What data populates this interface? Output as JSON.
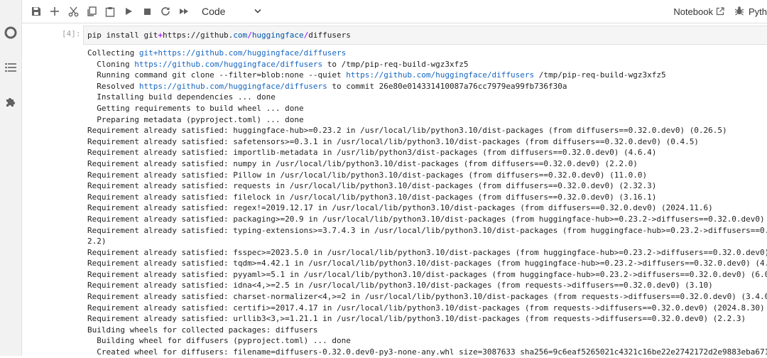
{
  "toolbar": {
    "cell_type": "Code",
    "notebook_label": "Notebook",
    "kernel_label": "Pyth"
  },
  "cell": {
    "prompt": "[4]:",
    "code_prefix": "pip install git",
    "code_op": "+",
    "code_url_prefix": "https://github.",
    "code_com": "com",
    "code_sep1": "/",
    "code_huggingface": "huggingface",
    "code_sep2": "/",
    "code_repo": "diffusers"
  },
  "output": {
    "lines": [
      {
        "pre": "Collecting ",
        "link": "git+https://github.com/huggingface/diffusers",
        "post": ""
      },
      {
        "pre": "  Cloning ",
        "link": "https://github.com/huggingface/diffusers",
        "post": " to /tmp/pip-req-build-wgz3xfz5"
      },
      {
        "pre": "  Running command git clone --filter=blob:none --quiet ",
        "link": "https://github.com/huggingface/diffusers",
        "post": " /tmp/pip-req-build-wgz3xfz5"
      },
      {
        "pre": "  Resolved ",
        "link": "https://github.com/huggingface/diffusers",
        "post": " to commit 26e80e014331410087a76cc7979ea99fb736f30a"
      },
      {
        "pre": "  Installing build dependencies ... done",
        "link": "",
        "post": ""
      },
      {
        "pre": "  Getting requirements to build wheel ... done",
        "link": "",
        "post": ""
      },
      {
        "pre": "  Preparing metadata (pyproject.toml) ... done",
        "link": "",
        "post": ""
      },
      {
        "pre": "Requirement already satisfied: huggingface-hub>=0.23.2 in /usr/local/lib/python3.10/dist-packages (from diffusers==0.32.0.dev0) (0.26.5)",
        "link": "",
        "post": ""
      },
      {
        "pre": "Requirement already satisfied: safetensors>=0.3.1 in /usr/local/lib/python3.10/dist-packages (from diffusers==0.32.0.dev0) (0.4.5)",
        "link": "",
        "post": ""
      },
      {
        "pre": "Requirement already satisfied: importlib-metadata in /usr/lib/python3/dist-packages (from diffusers==0.32.0.dev0) (4.6.4)",
        "link": "",
        "post": ""
      },
      {
        "pre": "Requirement already satisfied: numpy in /usr/local/lib/python3.10/dist-packages (from diffusers==0.32.0.dev0) (2.2.0)",
        "link": "",
        "post": ""
      },
      {
        "pre": "Requirement already satisfied: Pillow in /usr/local/lib/python3.10/dist-packages (from diffusers==0.32.0.dev0) (11.0.0)",
        "link": "",
        "post": ""
      },
      {
        "pre": "Requirement already satisfied: requests in /usr/local/lib/python3.10/dist-packages (from diffusers==0.32.0.dev0) (2.32.3)",
        "link": "",
        "post": ""
      },
      {
        "pre": "Requirement already satisfied: filelock in /usr/local/lib/python3.10/dist-packages (from diffusers==0.32.0.dev0) (3.16.1)",
        "link": "",
        "post": ""
      },
      {
        "pre": "Requirement already satisfied: regex!=2019.12.17 in /usr/local/lib/python3.10/dist-packages (from diffusers==0.32.0.dev0) (2024.11.6)",
        "link": "",
        "post": ""
      },
      {
        "pre": "Requirement already satisfied: packaging>=20.9 in /usr/local/lib/python3.10/dist-packages (from huggingface-hub>=0.23.2->diffusers==0.32.0.dev0)",
        "link": "",
        "post": ""
      },
      {
        "pre": "Requirement already satisfied: typing-extensions>=3.7.4.3 in /usr/local/lib/python3.10/dist-packages (from huggingface-hub>=0.23.2->diffusers==0.3",
        "link": "",
        "post": ""
      },
      {
        "pre": "2.2)",
        "link": "",
        "post": ""
      },
      {
        "pre": "Requirement already satisfied: fsspec>=2023.5.0 in /usr/local/lib/python3.10/dist-packages (from huggingface-hub>=0.23.2->diffusers==0.32.0.dev0)",
        "link": "",
        "post": ""
      },
      {
        "pre": "Requirement already satisfied: tqdm>=4.42.1 in /usr/local/lib/python3.10/dist-packages (from huggingface-hub>=0.23.2->diffusers==0.32.0.dev0) (4.6",
        "link": "",
        "post": ""
      },
      {
        "pre": "Requirement already satisfied: pyyaml>=5.1 in /usr/local/lib/python3.10/dist-packages (from huggingface-hub>=0.23.2->diffusers==0.32.0.dev0) (6.0",
        "link": "",
        "post": ""
      },
      {
        "pre": "Requirement already satisfied: idna<4,>=2.5 in /usr/local/lib/python3.10/dist-packages (from requests->diffusers==0.32.0.dev0) (3.10)",
        "link": "",
        "post": ""
      },
      {
        "pre": "Requirement already satisfied: charset-normalizer<4,>=2 in /usr/local/lib/python3.10/dist-packages (from requests->diffusers==0.32.0.dev0) (3.4.0",
        "link": "",
        "post": ""
      },
      {
        "pre": "Requirement already satisfied: certifi>=2017.4.17 in /usr/local/lib/python3.10/dist-packages (from requests->diffusers==0.32.0.dev0) (2024.8.30)",
        "link": "",
        "post": ""
      },
      {
        "pre": "Requirement already satisfied: urllib3<3,>=1.21.1 in /usr/local/lib/python3.10/dist-packages (from requests->diffusers==0.32.0.dev0) (2.2.3)",
        "link": "",
        "post": ""
      },
      {
        "pre": "Building wheels for collected packages: diffusers",
        "link": "",
        "post": ""
      },
      {
        "pre": "  Building wheel for diffusers (pyproject.toml) ... done",
        "link": "",
        "post": ""
      },
      {
        "pre": "  Created wheel for diffusers: filename=diffusers-0.32.0.dev0-py3-none-any.whl size=3087633 sha256=9c6eaf5265021c4321c16be22e2742172d2e9883eba671",
        "link": "",
        "post": ""
      }
    ]
  }
}
